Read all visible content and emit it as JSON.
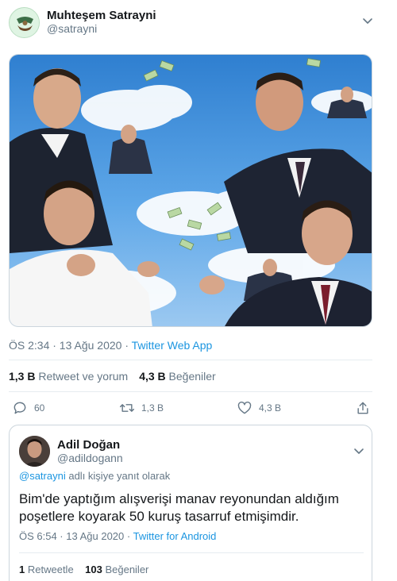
{
  "tweet": {
    "author_name": "Muhteşem Satrayni",
    "author_handle": "@satrayni",
    "timestamp": "ÖS 2:34 · 13 Ağu 2020",
    "separator": " · ",
    "source_app": "Twitter Web App",
    "retweets_count": "1,3 B",
    "retweets_label": "Retweet ve yorum",
    "likes_count": "4,3 B",
    "likes_label": "Beğeniler",
    "action_reply_count": "60",
    "action_retweet_count": "1,3 B",
    "action_like_count": "4,3 B"
  },
  "reply": {
    "author_name": "Adil Doğan",
    "author_handle": "@adildogann",
    "replying_mention": "@satrayni",
    "replying_suffix": "adlı kişiye yanıt olarak",
    "text": "Bim'de yaptığım alışverişi manav reyonundan aldığım poşetlere koyarak 50 kuruş tasarruf etmişimdir.",
    "timestamp": "ÖS 6:54 · 13 Ağu 2020",
    "separator": " · ",
    "source_app": "Twitter for Android",
    "retweets_count": "1",
    "retweets_label": "Retweetle",
    "likes_count": "103",
    "likes_label": "Beğeniler"
  },
  "colors": {
    "accent": "#1b95e0",
    "secondary_text": "#657786",
    "primary_text": "#14171a"
  },
  "icons": [
    "chevron-down-icon",
    "reply-icon",
    "retweet-icon",
    "heart-icon",
    "share-icon"
  ]
}
